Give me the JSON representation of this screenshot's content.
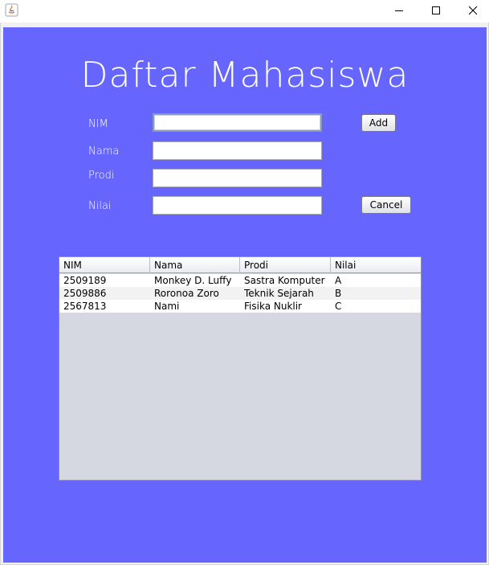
{
  "window": {
    "title": ""
  },
  "header": {
    "title": "Daftar Mahasiswa"
  },
  "form": {
    "nim": {
      "label": "NIM",
      "value": ""
    },
    "nama": {
      "label": "Nama",
      "value": ""
    },
    "prodi": {
      "label": "Prodi",
      "value": ""
    },
    "nilai": {
      "label": "Nilai",
      "value": ""
    },
    "add_label": "Add",
    "cancel_label": "Cancel"
  },
  "table": {
    "columns": [
      "NIM",
      "Nama",
      "Prodi",
      "Nilai"
    ],
    "rows": [
      [
        "2509189",
        "Monkey D. Luffy",
        "Sastra Komputer",
        "A"
      ],
      [
        "2509886",
        "Roronoa Zoro",
        "Teknik Sejarah",
        "B"
      ],
      [
        "2567813",
        "Nami",
        "Fisika Nuklir",
        "C"
      ]
    ]
  },
  "colors": {
    "background": "#6666ff",
    "title_text": "#ffffff"
  },
  "icons": {
    "app": "java-coffee-icon",
    "minimize": "minimize-icon",
    "maximize": "maximize-icon",
    "close": "close-icon"
  }
}
